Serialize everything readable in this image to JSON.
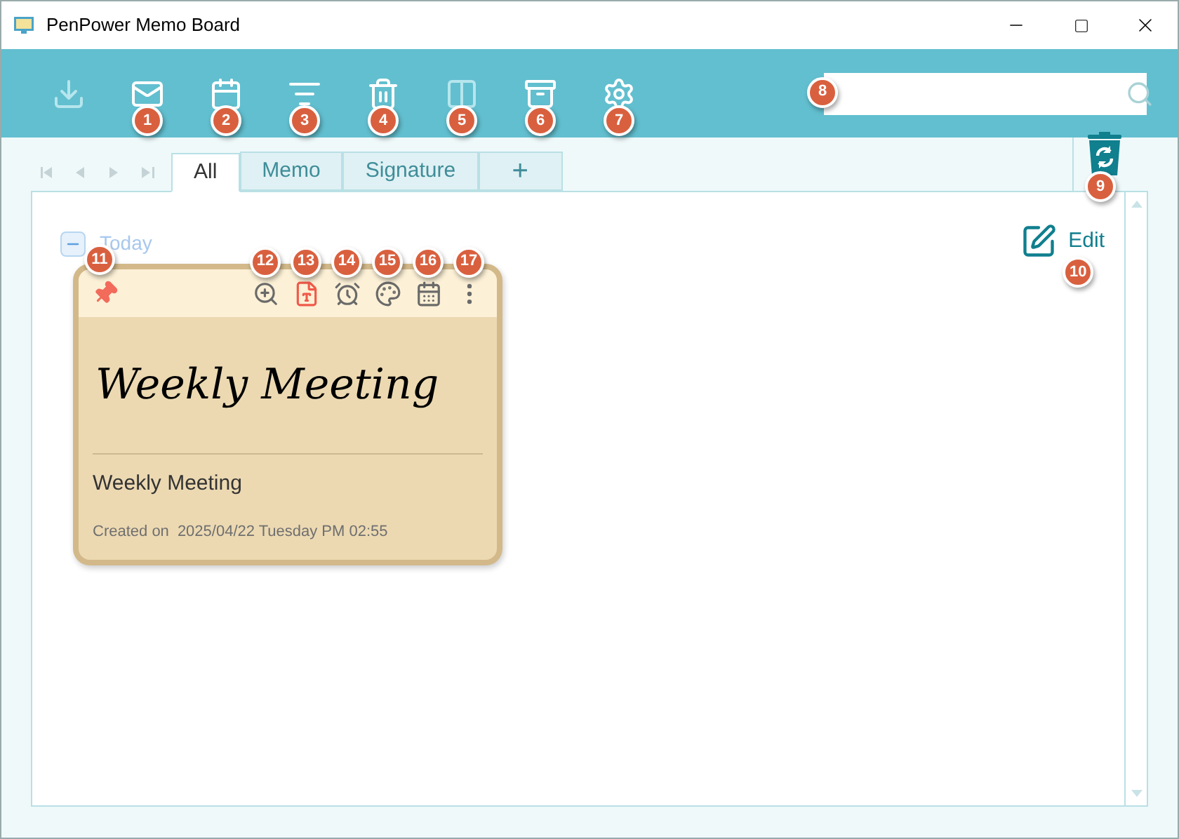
{
  "window": {
    "title": "PenPower Memo Board"
  },
  "toolbar": [
    {
      "kind": "download",
      "disabled": true
    },
    {
      "kind": "mail-sign",
      "disabled": false,
      "callout": "1"
    },
    {
      "kind": "calendar",
      "disabled": false,
      "callout": "2"
    },
    {
      "kind": "list-select",
      "disabled": false,
      "callout": "3"
    },
    {
      "kind": "trash",
      "disabled": false,
      "callout": "4"
    },
    {
      "kind": "split",
      "disabled": true,
      "callout": "5"
    },
    {
      "kind": "archive",
      "disabled": false,
      "callout": "6"
    },
    {
      "kind": "settings",
      "disabled": false,
      "callout": "7"
    }
  ],
  "search": {
    "callout": "8"
  },
  "recycle_bin": {
    "callout": "9"
  },
  "tabs": [
    {
      "label": "All",
      "selected": true
    },
    {
      "label": "Memo",
      "selected": false
    },
    {
      "label": "Signature",
      "selected": false
    },
    {
      "label": "+",
      "selected": false
    }
  ],
  "group": {
    "label": "Today",
    "expanded": true
  },
  "edit": {
    "label": "Edit",
    "callout": "10"
  },
  "card": {
    "pinned": true,
    "pin_callout": "11",
    "tools": [
      {
        "kind": "zoom",
        "active": false,
        "callout": "12"
      },
      {
        "kind": "text",
        "active": true,
        "callout": "13"
      },
      {
        "kind": "alarm",
        "active": false,
        "callout": "14"
      },
      {
        "kind": "palette",
        "active": false,
        "callout": "15"
      },
      {
        "kind": "calendar",
        "active": false,
        "callout": "16"
      },
      {
        "kind": "more",
        "active": false,
        "callout": "17"
      }
    ],
    "ink": "Weekly Meeting",
    "title": "Weekly Meeting",
    "created_label": "Created on",
    "created": "2025/04/22 Tuesday PM 02:55"
  }
}
